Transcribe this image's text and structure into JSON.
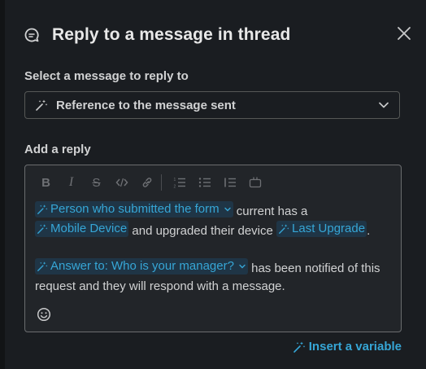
{
  "dialog": {
    "title": "Reply to a message in thread",
    "close_label": "Close"
  },
  "select_section": {
    "label": "Select a message to reply to",
    "selected_value": "Reference to the message sent"
  },
  "reply_section": {
    "label": "Add a reply",
    "toolbar": [
      "bold",
      "italic",
      "strikethrough",
      "code",
      "link",
      "ordered-list",
      "bulleted-list",
      "numbered-list",
      "code-block"
    ],
    "paragraph1": {
      "chip_form": "Person who submitted the form",
      "text1": " current has a ",
      "chip_device": "Mobile Device",
      "text2": " and upgraded their device ",
      "chip_upgrade": "Last Upgrade",
      "text3": "."
    },
    "paragraph2": {
      "chip_answer": "Answer to: Who is your manager?",
      "text1": " has been notified of this request and they will respond with a message."
    }
  },
  "footer": {
    "insert_variable": "Insert a variable"
  },
  "colors": {
    "background": "#1a1d21",
    "accent": "#36a6d6",
    "chip_bg": "#1f3546",
    "text": "#d1d2d3"
  }
}
